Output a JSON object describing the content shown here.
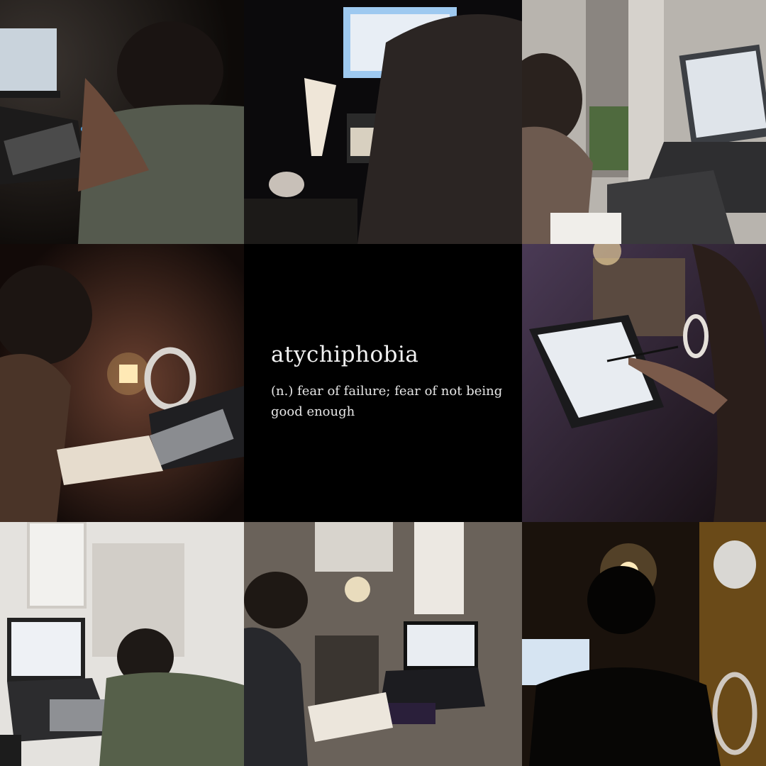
{
  "caption": {
    "word": "atychiphobia",
    "definition": "(n.) fear of failure; fear of not being good enough"
  },
  "photos": [
    {
      "id": "photo-1",
      "scene": "person resting head on hand beside laptop and mechanical keyboard"
    },
    {
      "id": "photo-2",
      "scene": "person from behind looking at monitor with desk lamp"
    },
    {
      "id": "photo-3",
      "scene": "person with glasses writing beside laptop and bookshelf"
    },
    {
      "id": "photo-4",
      "scene": "person reading a book beside headphones and lamp"
    },
    {
      "id": "photo-6",
      "scene": "person writing on a tablet screen with stylus"
    },
    {
      "id": "photo-7",
      "scene": "person studying in front of laptop in bright room"
    },
    {
      "id": "photo-8",
      "scene": "person writing notes in front of laptop with shelf"
    },
    {
      "id": "photo-9",
      "scene": "silhouette of person facing monitor with lamp glow"
    }
  ],
  "colors": {
    "background": "#000000",
    "text": "#f2f2f2"
  }
}
